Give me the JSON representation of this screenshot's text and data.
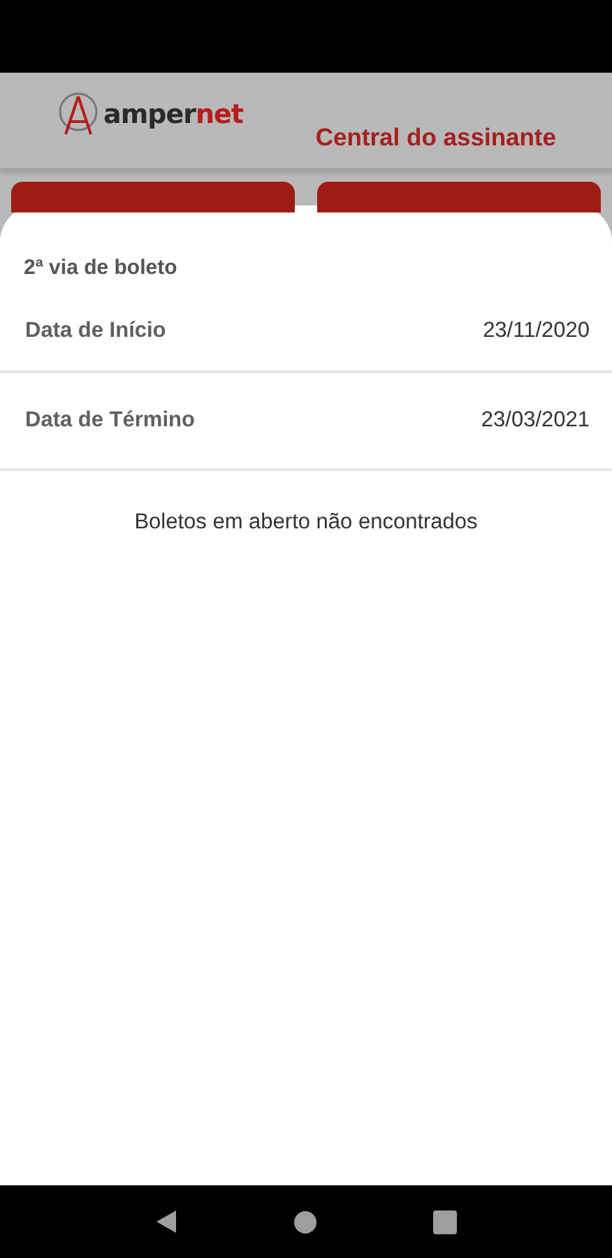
{
  "header": {
    "logo": {
      "name": "amper",
      "accent": "net"
    },
    "title": "Central do assinante"
  },
  "sheet": {
    "title": "2ª via de boleto",
    "fields": [
      {
        "label": "Data de Início",
        "value": "23/11/2020"
      },
      {
        "label": "Data de Término",
        "value": "23/03/2021"
      }
    ],
    "message": "Boletos em aberto não encontrados"
  }
}
